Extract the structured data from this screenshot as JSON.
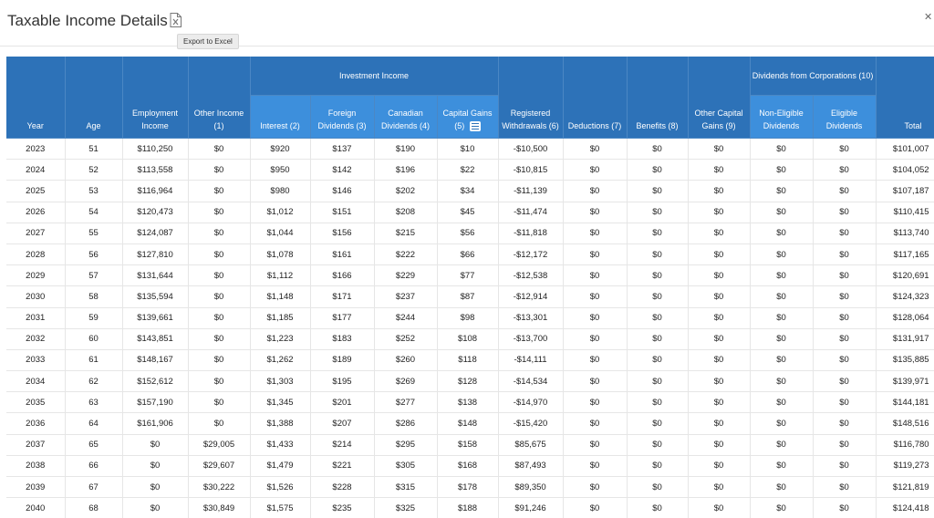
{
  "header": {
    "title": "Taxable Income Details",
    "export_icon": "excel-file-icon",
    "tooltip": "Export to Excel",
    "close_icon": "close-icon"
  },
  "table": {
    "columns": {
      "year": "Year",
      "age": "Age",
      "employment": "Employment Income",
      "other_income": "Other Income (1)",
      "investment_group": "Investment Income",
      "interest": "Interest (2)",
      "foreign": "Foreign Dividends (3)",
      "canadian": "Canadian Dividends (4)",
      "capital_gains": "Capital Gains (5)",
      "rrsp": "Registered Withdrawals (6)",
      "deductions": "Deductions (7)",
      "benefits": "Benefits (8)",
      "other_cg": "Other Capital Gains (9)",
      "dividends_group": "Dividends from Corporations (10)",
      "non_eligible": "Non-Eligible Dividends",
      "eligible": "Eligible Dividends",
      "total": "Total"
    },
    "rows": [
      [
        "2023",
        "51",
        "$110,250",
        "$0",
        "$920",
        "$137",
        "$190",
        "$10",
        "-$10,500",
        "$0",
        "$0",
        "$0",
        "$0",
        "$0",
        "$101,007"
      ],
      [
        "2024",
        "52",
        "$113,558",
        "$0",
        "$950",
        "$142",
        "$196",
        "$22",
        "-$10,815",
        "$0",
        "$0",
        "$0",
        "$0",
        "$0",
        "$104,052"
      ],
      [
        "2025",
        "53",
        "$116,964",
        "$0",
        "$980",
        "$146",
        "$202",
        "$34",
        "-$11,139",
        "$0",
        "$0",
        "$0",
        "$0",
        "$0",
        "$107,187"
      ],
      [
        "2026",
        "54",
        "$120,473",
        "$0",
        "$1,012",
        "$151",
        "$208",
        "$45",
        "-$11,474",
        "$0",
        "$0",
        "$0",
        "$0",
        "$0",
        "$110,415"
      ],
      [
        "2027",
        "55",
        "$124,087",
        "$0",
        "$1,044",
        "$156",
        "$215",
        "$56",
        "-$11,818",
        "$0",
        "$0",
        "$0",
        "$0",
        "$0",
        "$113,740"
      ],
      [
        "2028",
        "56",
        "$127,810",
        "$0",
        "$1,078",
        "$161",
        "$222",
        "$66",
        "-$12,172",
        "$0",
        "$0",
        "$0",
        "$0",
        "$0",
        "$117,165"
      ],
      [
        "2029",
        "57",
        "$131,644",
        "$0",
        "$1,112",
        "$166",
        "$229",
        "$77",
        "-$12,538",
        "$0",
        "$0",
        "$0",
        "$0",
        "$0",
        "$120,691"
      ],
      [
        "2030",
        "58",
        "$135,594",
        "$0",
        "$1,148",
        "$171",
        "$237",
        "$87",
        "-$12,914",
        "$0",
        "$0",
        "$0",
        "$0",
        "$0",
        "$124,323"
      ],
      [
        "2031",
        "59",
        "$139,661",
        "$0",
        "$1,185",
        "$177",
        "$244",
        "$98",
        "-$13,301",
        "$0",
        "$0",
        "$0",
        "$0",
        "$0",
        "$128,064"
      ],
      [
        "2032",
        "60",
        "$143,851",
        "$0",
        "$1,223",
        "$183",
        "$252",
        "$108",
        "-$13,700",
        "$0",
        "$0",
        "$0",
        "$0",
        "$0",
        "$131,917"
      ],
      [
        "2033",
        "61",
        "$148,167",
        "$0",
        "$1,262",
        "$189",
        "$260",
        "$118",
        "-$14,111",
        "$0",
        "$0",
        "$0",
        "$0",
        "$0",
        "$135,885"
      ],
      [
        "2034",
        "62",
        "$152,612",
        "$0",
        "$1,303",
        "$195",
        "$269",
        "$128",
        "-$14,534",
        "$0",
        "$0",
        "$0",
        "$0",
        "$0",
        "$139,971"
      ],
      [
        "2035",
        "63",
        "$157,190",
        "$0",
        "$1,345",
        "$201",
        "$277",
        "$138",
        "-$14,970",
        "$0",
        "$0",
        "$0",
        "$0",
        "$0",
        "$144,181"
      ],
      [
        "2036",
        "64",
        "$161,906",
        "$0",
        "$1,388",
        "$207",
        "$286",
        "$148",
        "-$15,420",
        "$0",
        "$0",
        "$0",
        "$0",
        "$0",
        "$148,516"
      ],
      [
        "2037",
        "65",
        "$0",
        "$29,005",
        "$1,433",
        "$214",
        "$295",
        "$158",
        "$85,675",
        "$0",
        "$0",
        "$0",
        "$0",
        "$0",
        "$116,780"
      ],
      [
        "2038",
        "66",
        "$0",
        "$29,607",
        "$1,479",
        "$221",
        "$305",
        "$168",
        "$87,493",
        "$0",
        "$0",
        "$0",
        "$0",
        "$0",
        "$119,273"
      ],
      [
        "2039",
        "67",
        "$0",
        "$30,222",
        "$1,526",
        "$228",
        "$315",
        "$178",
        "$89,350",
        "$0",
        "$0",
        "$0",
        "$0",
        "$0",
        "$121,819"
      ],
      [
        "2040",
        "68",
        "$0",
        "$30,849",
        "$1,575",
        "$235",
        "$325",
        "$188",
        "$91,246",
        "$0",
        "$0",
        "$0",
        "$0",
        "$0",
        "$124,418"
      ]
    ]
  }
}
